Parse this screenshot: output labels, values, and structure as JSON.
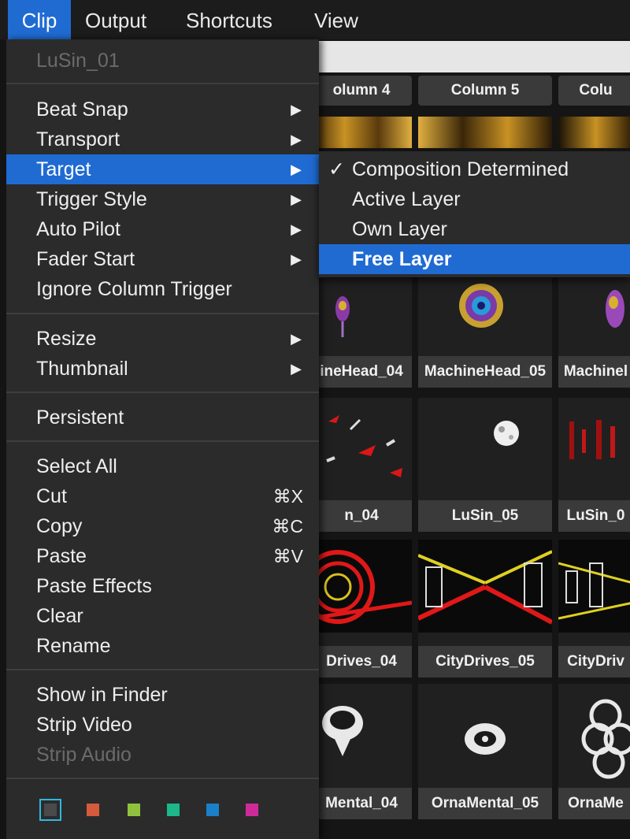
{
  "menubar": {
    "items": [
      {
        "label": "Clip",
        "active": true
      },
      {
        "label": "Output",
        "active": false
      },
      {
        "label": "Shortcuts",
        "active": false
      },
      {
        "label": "View",
        "active": false
      }
    ]
  },
  "grid": {
    "columns": [
      "olumn 4",
      "Column 5",
      "Colu"
    ],
    "rows": [
      [
        "ineHead_04",
        "MachineHead_05",
        "Machinel"
      ],
      [
        "n_04",
        "LuSin_05",
        "LuSin_0"
      ],
      [
        "Drives_04",
        "CityDrives_05",
        "CityDriv"
      ],
      [
        "Mental_04",
        "OrnaMental_05",
        "OrnaMe"
      ]
    ]
  },
  "clip_menu": {
    "header": "LuSin_01",
    "items": {
      "beat_snap": "Beat Snap",
      "transport": "Transport",
      "target": "Target",
      "trigger_style": "Trigger Style",
      "auto_pilot": "Auto Pilot",
      "fader_start": "Fader Start",
      "ignore_column_trigger": "Ignore Column Trigger",
      "resize": "Resize",
      "thumbnail": "Thumbnail",
      "persistent": "Persistent",
      "select_all": "Select All",
      "cut": "Cut",
      "copy": "Copy",
      "paste": "Paste",
      "paste_effects": "Paste Effects",
      "clear": "Clear",
      "rename": "Rename",
      "show_in_finder": "Show in Finder",
      "strip_video": "Strip Video",
      "strip_audio": "Strip Audio"
    },
    "shortcuts": {
      "cut": "⌘X",
      "copy": "⌘C",
      "paste": "⌘V"
    },
    "submenu_arrow": "▶",
    "colors": [
      "#4a4a4a",
      "#d65a3c",
      "#8fc23c",
      "#1ab88a",
      "#1a80c8",
      "#cf2a9a"
    ]
  },
  "target_submenu": {
    "check": "✓",
    "items": [
      "Composition Determined",
      "Active Layer",
      "Own Layer",
      "Free Layer"
    ],
    "checked": "Composition Determined",
    "highlighted": "Free Layer"
  },
  "theme": {
    "accent": "#1f6bd2",
    "menu_bg": "#2b2b2b",
    "selection_border": "#2fb7e0"
  }
}
